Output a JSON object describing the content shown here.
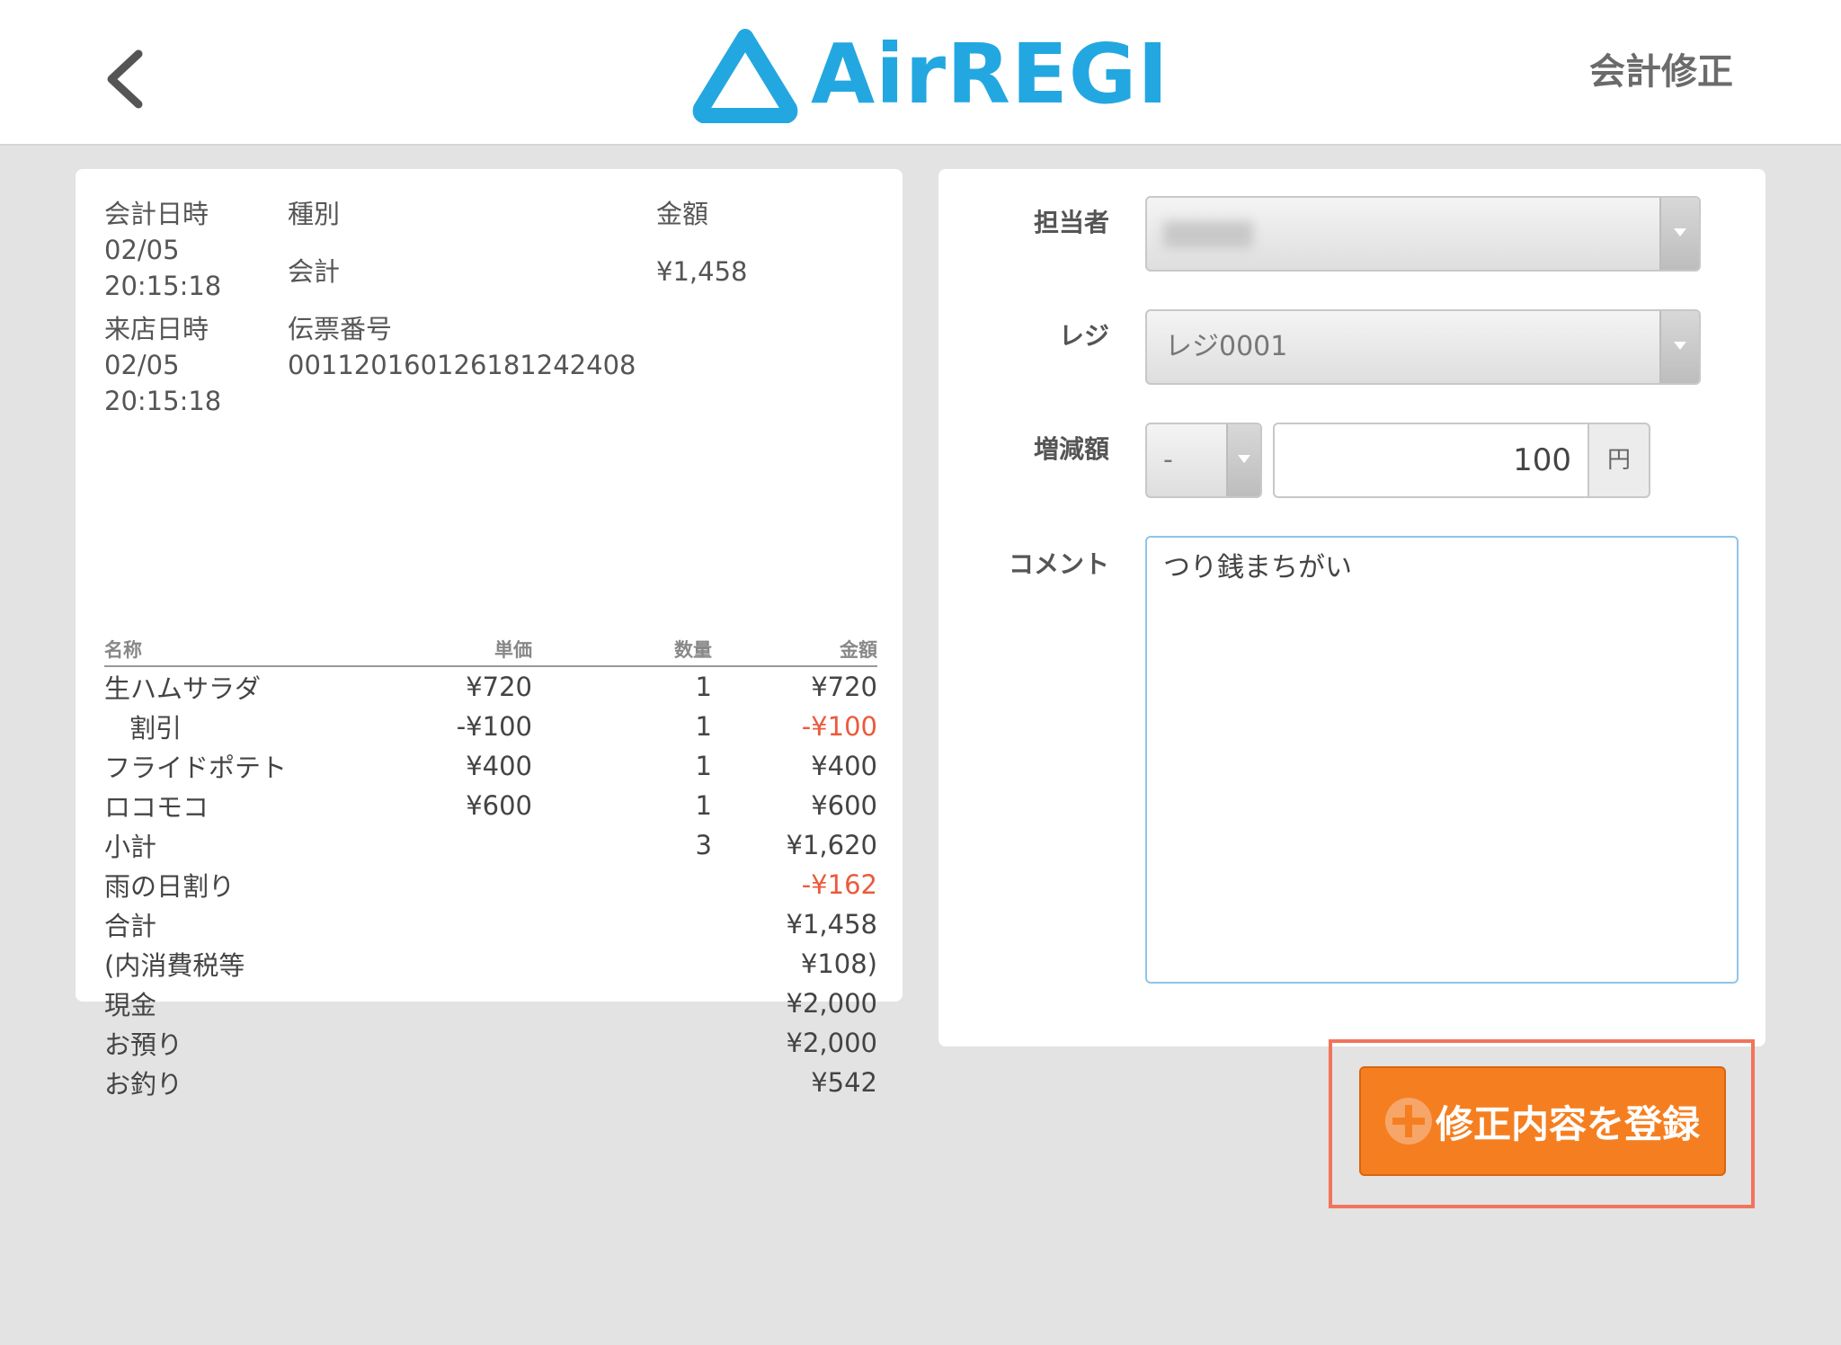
{
  "header": {
    "logo_text": "AirREGI",
    "title": "会計修正"
  },
  "colors": {
    "brand": "#23a7e0",
    "accent": "#f57f20",
    "negative": "#ea5a3c",
    "highlight": "#f2735d"
  },
  "receipt": {
    "meta": {
      "date_label": "会計日時",
      "date_value_1": "02/05",
      "date_value_2": "20:15:18",
      "type_label": "種別",
      "type_value": "会計",
      "amount_label": "金額",
      "amount_value": "¥1,458",
      "visit_label": "来店日時",
      "visit_value_1": "02/05",
      "visit_value_2": "20:15:18",
      "slip_label": "伝票番号",
      "slip_value": "00112016012618124​2408"
    },
    "columns": [
      "名称",
      "単価",
      "数量",
      "金額"
    ],
    "rows": [
      {
        "name": "生ハムサラダ",
        "price": "¥720",
        "qty": "1",
        "amount": "¥720"
      },
      {
        "name": "割引",
        "price": "-¥100",
        "qty": "1",
        "amount": "-¥100"
      },
      {
        "name": "フライドポテト",
        "price": "¥400",
        "qty": "1",
        "amount": "¥400"
      },
      {
        "name": "ロコモコ",
        "price": "¥600",
        "qty": "1",
        "amount": "¥600"
      },
      {
        "name": "小計",
        "price": "",
        "qty": "3",
        "amount": "¥1,620"
      },
      {
        "name": "雨の日割り",
        "price": "",
        "qty": "",
        "amount": "-¥162"
      },
      {
        "name": "合計",
        "price": "",
        "qty": "",
        "amount": "¥1,458"
      },
      {
        "name": "(内消費税等",
        "price": "",
        "qty": "",
        "amount": "¥108)"
      },
      {
        "name": "現金",
        "price": "",
        "qty": "",
        "amount": "¥2,000"
      },
      {
        "name": "お預り",
        "price": "",
        "qty": "",
        "amount": "¥2,000"
      },
      {
        "name": "お釣り",
        "price": "",
        "qty": "",
        "amount": "¥542"
      }
    ]
  },
  "form": {
    "staff_label": "担当者",
    "register_label": "レジ",
    "register_value": "レジ0001",
    "adjust_label": "増減額",
    "adjust_sign": "-",
    "adjust_amount": "100",
    "adjust_unit": "円",
    "comment_label": "コメント",
    "comment_value": "つり銭まちがい"
  },
  "actions": {
    "submit_label": "修正内容を登録"
  },
  "icons": {
    "back": "chevron-left-icon",
    "logo": "triangle-logo-icon",
    "submit": "plus-circle-icon"
  }
}
